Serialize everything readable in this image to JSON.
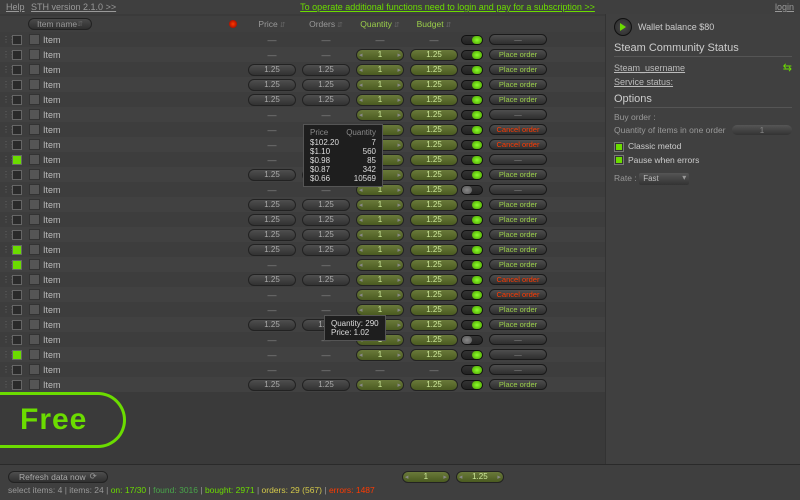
{
  "topbar": {
    "help": "Help",
    "version": "STH version 2.1.0 >>",
    "promo": "To operate additional functions need to login and pay for a subscription >>",
    "login": "login"
  },
  "sidebar": {
    "wallet": "Wallet balance $80",
    "community_head": "Steam Community Status",
    "steam_user": "Steam_username",
    "service_status_label": "Service status:",
    "options_head": "Options",
    "buy_order_label": "Buy order :",
    "qty_label": "Quantity of items in one order",
    "qty_value": "1",
    "classic": "Classic metod",
    "pause": "Pause when errors",
    "rate_label": "Rate :",
    "rate_value": "Fast"
  },
  "columns": {
    "name": "Item name",
    "price": "Price",
    "orders": "Orders",
    "quantity": "Quantity",
    "budget": "Budget"
  },
  "row_defaults": {
    "name": "Item",
    "price": "1.25",
    "orders": "1.25",
    "qty": "1",
    "budget": "1.25"
  },
  "labels": {
    "place": "Place order",
    "cancel": "Cancel order",
    "dash": "—"
  },
  "rows": [
    {
      "chk": false,
      "p": false,
      "o": false,
      "q": false,
      "b": false,
      "tg": "on",
      "act": "dash"
    },
    {
      "chk": false,
      "p": false,
      "o": false,
      "q": true,
      "b": true,
      "tg": "on",
      "act": "place"
    },
    {
      "chk": false,
      "p": true,
      "o": true,
      "q": true,
      "b": true,
      "tg": "on",
      "act": "place"
    },
    {
      "chk": false,
      "p": true,
      "o": true,
      "q": true,
      "b": true,
      "tg": "on",
      "act": "place"
    },
    {
      "chk": false,
      "p": true,
      "o": true,
      "q": true,
      "b": true,
      "tg": "on",
      "act": "place"
    },
    {
      "chk": false,
      "p": false,
      "o": false,
      "q": true,
      "b": true,
      "tg": "on",
      "act": "dash"
    },
    {
      "chk": false,
      "p": false,
      "o": false,
      "q": true,
      "b": true,
      "tg": "on",
      "act": "cancel"
    },
    {
      "chk": false,
      "p": false,
      "o": false,
      "q": true,
      "b": true,
      "tg": "on",
      "act": "cancel"
    },
    {
      "chk": true,
      "p": false,
      "o": false,
      "q": true,
      "b": true,
      "tg": "on",
      "act": "dash"
    },
    {
      "chk": false,
      "p": true,
      "o": true,
      "q": true,
      "b": true,
      "tg": "on",
      "act": "place"
    },
    {
      "chk": false,
      "p": false,
      "o": false,
      "q": true,
      "b": true,
      "tg": "off",
      "act": "dash"
    },
    {
      "chk": false,
      "p": true,
      "o": true,
      "q": true,
      "b": true,
      "tg": "on",
      "act": "place"
    },
    {
      "chk": false,
      "p": true,
      "o": true,
      "q": true,
      "b": true,
      "tg": "on",
      "act": "place"
    },
    {
      "chk": false,
      "p": true,
      "o": true,
      "q": true,
      "b": true,
      "tg": "on",
      "act": "place"
    },
    {
      "chk": true,
      "p": true,
      "o": true,
      "q": true,
      "b": true,
      "tg": "on",
      "act": "place"
    },
    {
      "chk": true,
      "p": false,
      "o": false,
      "q": true,
      "b": true,
      "tg": "on",
      "act": "place"
    },
    {
      "chk": false,
      "p": true,
      "o": true,
      "q": true,
      "b": true,
      "tg": "on",
      "act": "cancel"
    },
    {
      "chk": false,
      "p": false,
      "o": false,
      "q": true,
      "b": true,
      "tg": "on",
      "act": "cancel"
    },
    {
      "chk": false,
      "p": false,
      "o": false,
      "q": true,
      "b": true,
      "tg": "on",
      "act": "place"
    },
    {
      "chk": false,
      "p": true,
      "o": true,
      "q": true,
      "b": true,
      "tg": "on",
      "act": "place"
    },
    {
      "chk": false,
      "p": false,
      "o": false,
      "q": true,
      "b": true,
      "tg": "off",
      "act": "dash"
    },
    {
      "chk": true,
      "p": false,
      "o": false,
      "q": true,
      "b": true,
      "tg": "on",
      "act": "dash"
    },
    {
      "chk": false,
      "p": false,
      "o": false,
      "q": false,
      "b": false,
      "tg": "on",
      "act": "dash"
    },
    {
      "chk": false,
      "p": true,
      "o": true,
      "q": true,
      "b": true,
      "tg": "on",
      "act": "place"
    }
  ],
  "tooltip1": {
    "h_price": "Price",
    "h_qty": "Quantity",
    "rows": [
      [
        "$102.20",
        "7"
      ],
      [
        "$1.10",
        "560"
      ],
      [
        "$0.98",
        "85"
      ],
      [
        "$0.87",
        "342"
      ],
      [
        "$0.66",
        "10569"
      ]
    ]
  },
  "tooltip2": {
    "l1": "Quantity: 290",
    "l2": "Price:   1.02"
  },
  "free": "Free",
  "footer": {
    "refresh": "Refresh data now",
    "qty": "1",
    "budget": "1.25",
    "stats": {
      "select": "select items: 4",
      "items": "items: 24",
      "on": "on: 17/30",
      "found": "found: 3016",
      "bought": "bought: 2971",
      "orders": "orders: 29 (567)",
      "errors": "errors: 1487"
    }
  }
}
